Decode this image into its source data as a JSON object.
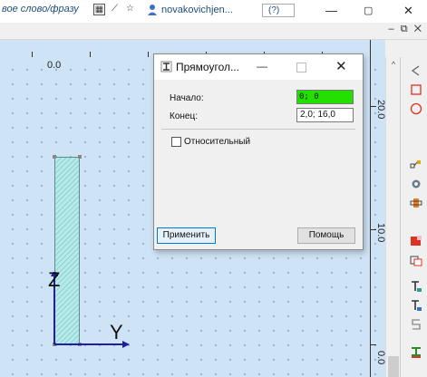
{
  "titlebar": {
    "search_hint": "вое слово/фразу",
    "user_name": "novakovichjen...",
    "help_label": "(?)",
    "minimize": "—",
    "restore": "▢",
    "close": "✕",
    "mdi_controls": "– ⧉ ✕"
  },
  "canvas": {
    "x_label": "0.0",
    "y_labels": [
      "20.0",
      "10.0",
      "0.0"
    ],
    "axis_z": "Z",
    "axis_y": "Y",
    "rect_fill": "#a9e2e2"
  },
  "dialog": {
    "title": "Прямоугол...",
    "start_label": "Начало:",
    "start_value": "0; 0",
    "end_label": "Конец:",
    "end_value": "2,0; 16,0",
    "relative_label": "Относительный",
    "relative_checked": false,
    "apply_label": "Применить",
    "help_label": "Помощь",
    "start_highlight": "#22e000"
  },
  "toolbar_icons": [
    "curve-icon",
    "rectangle-icon",
    "circle-icon",
    "node-icon",
    "gear-icon",
    "section-icon",
    "red-section-icon",
    "copy-icon",
    "t-beam-icon",
    "t-beam-alt-icon",
    "s-shape-icon",
    "green-beam-icon"
  ]
}
